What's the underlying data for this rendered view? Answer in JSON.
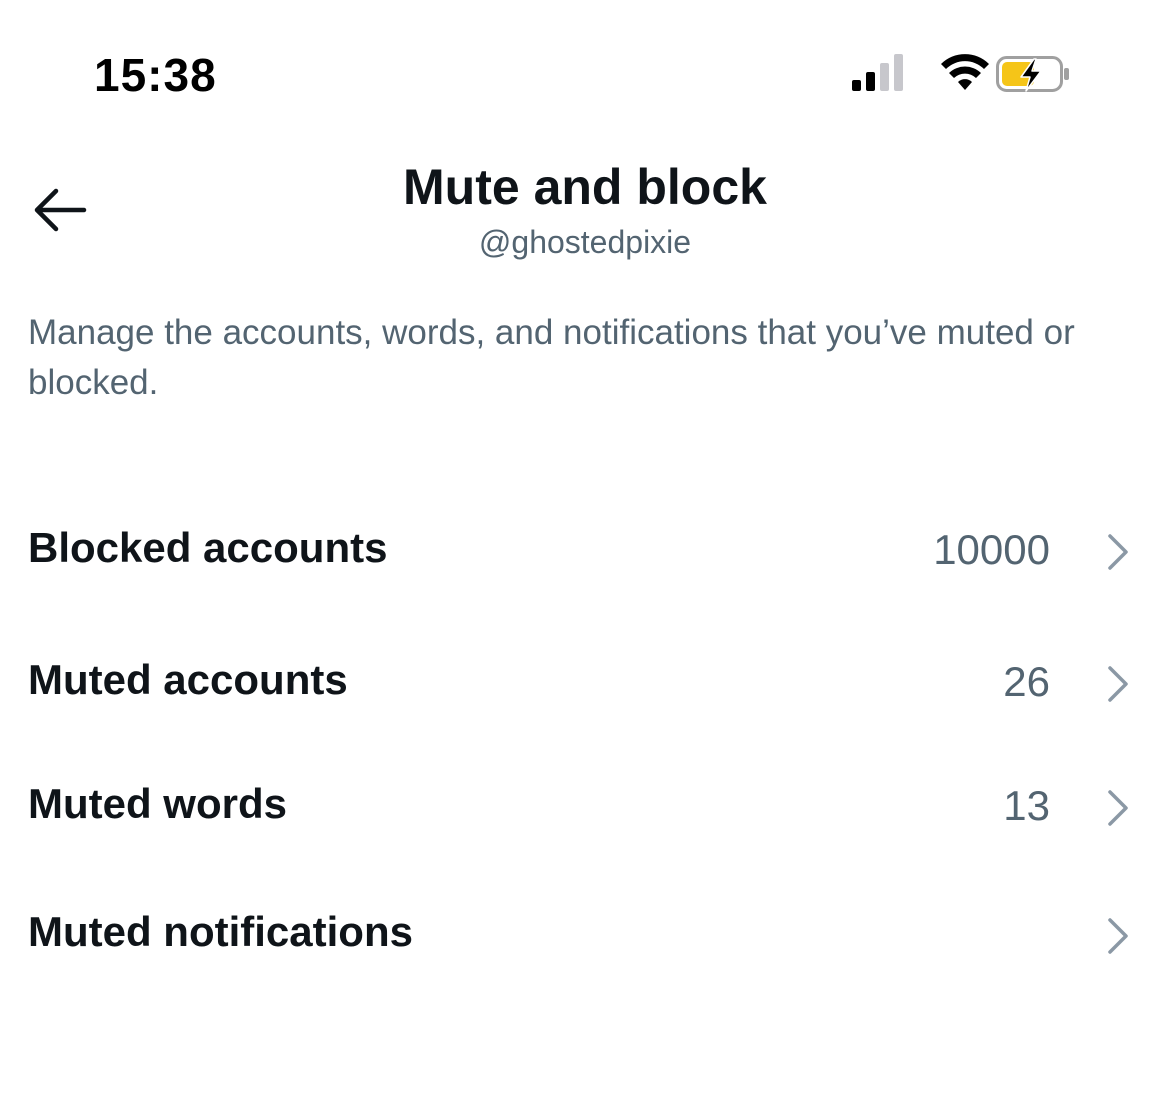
{
  "status_bar": {
    "time": "15:38",
    "signal_icon": "cellular-signal-icon",
    "wifi_icon": "wifi-icon",
    "battery_icon": "battery-charging-icon",
    "battery_color": "#f5c518"
  },
  "header": {
    "back_icon": "back-arrow-icon",
    "title": "Mute and block",
    "subtitle": "@ghostedpixie"
  },
  "description": "Manage the accounts, words, and notifications that you’ve muted or blocked.",
  "settings": {
    "items": [
      {
        "label": "Blocked accounts",
        "count": "10000"
      },
      {
        "label": "Muted accounts",
        "count": "26"
      },
      {
        "label": "Muted words",
        "count": "13"
      },
      {
        "label": "Muted notifications",
        "count": ""
      }
    ],
    "chevron_icon": "chevron-right-icon"
  },
  "colors": {
    "primary_text": "#0f1419",
    "secondary_text": "#536471",
    "chevron": "#8b98a5"
  }
}
